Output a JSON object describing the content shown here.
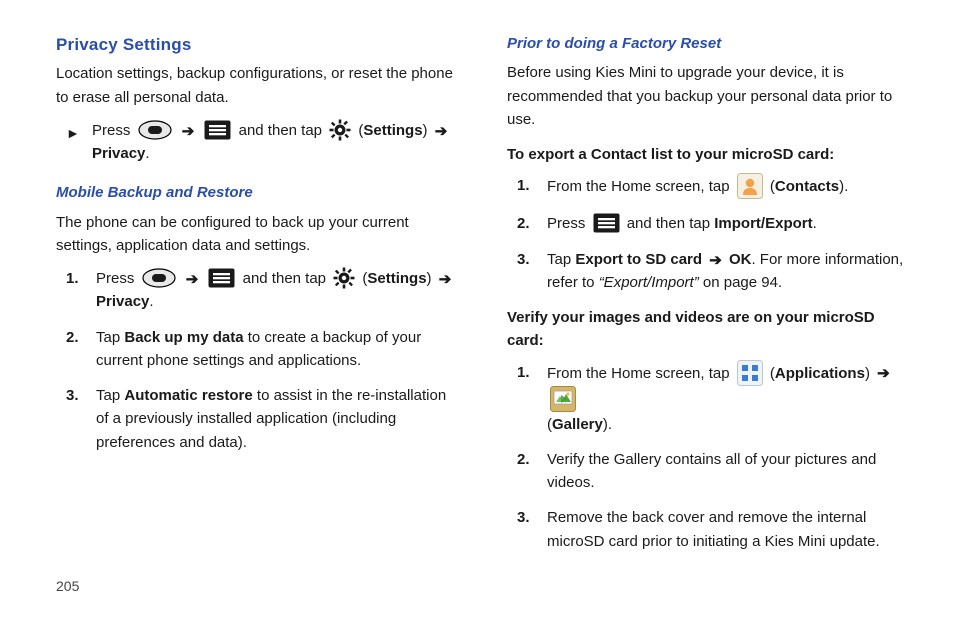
{
  "pageNumber": "205",
  "left": {
    "h1": "Privacy Settings",
    "intro": "Location settings, backup configurations, or reset the phone to erase all personal data.",
    "pressRow": {
      "press": "Press ",
      "andThenTap": " and then tap ",
      "settings": "Settings",
      "privacy": "Privacy"
    },
    "h2": "Mobile Backup and Restore",
    "para2": "The phone can be configured to back up your current settings, application data and settings.",
    "steps": [
      {
        "n": "1.",
        "press": "Press ",
        "andThenTap": " and then tap ",
        "settings": "Settings",
        "privacy": "Privacy"
      },
      {
        "n": "2.",
        "tap": "Tap ",
        "bold": "Back up my data",
        "rest": " to create a backup of your current phone settings and applications."
      },
      {
        "n": "3.",
        "tap": "Tap ",
        "bold": "Automatic restore",
        "rest": " to assist in the re-installation of a previously installed application (including preferences and data)."
      }
    ]
  },
  "right": {
    "h2": "Prior to doing a Factory Reset",
    "intro": "Before using Kies Mini to upgrade your device, it is recommended that you backup your personal data prior to use.",
    "sub1": "To export a Contact list to your microSD card:",
    "block1": [
      {
        "n": "1.",
        "pre": "From the Home screen, tap ",
        "paren": "Contacts",
        "post": "."
      },
      {
        "n": "2.",
        "press": "Press ",
        "andThenTap": " and then tap ",
        "bold": "Import/Export",
        "post": "."
      },
      {
        "n": "3.",
        "tap": "Tap ",
        "bold1": "Export to SD card",
        "bold2": "OK",
        "rest1": ". For more information, refer to ",
        "italic": "“Export/Import”",
        "rest2": "  on page 94."
      }
    ],
    "sub2": "Verify your images and videos are on your microSD card:",
    "block2": [
      {
        "n": "1.",
        "pre": "From the Home screen, tap ",
        "parenApps": "Applications",
        "parenGallery": "Gallery",
        "post": "."
      },
      {
        "n": "2.",
        "text": "Verify the Gallery contains all of your pictures and videos."
      },
      {
        "n": "3.",
        "text": "Remove the back cover and remove the internal microSD card prior to initiating a Kies Mini update."
      }
    ]
  }
}
